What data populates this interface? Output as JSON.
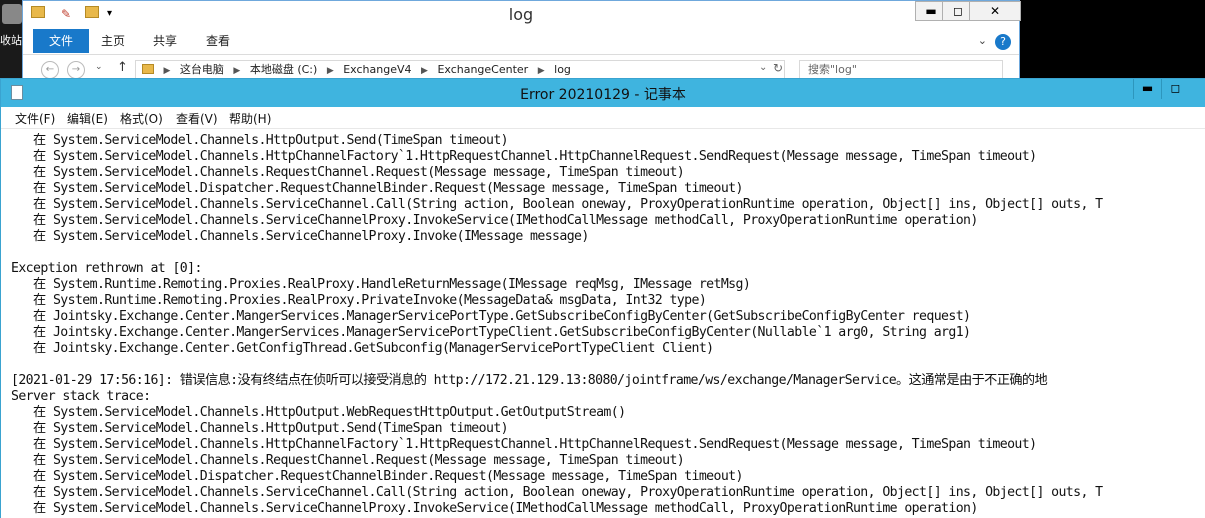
{
  "desktop": {
    "label": "收站"
  },
  "explorer": {
    "title": "log",
    "minimize": "▬",
    "maximize": "◻",
    "close": "✕",
    "tabs": [
      "文件",
      "主页",
      "共享",
      "查看"
    ],
    "help": "?",
    "breadcrumb": [
      "这台电脑",
      "本地磁盘 (C:)",
      "ExchangeV4",
      "ExchangeCenter",
      "log"
    ],
    "search_placeholder": "搜索\"log\""
  },
  "notepad": {
    "title": "Error 20210129 - 记事本",
    "minimize": "▬",
    "maximize": "◻",
    "menu": [
      "文件(F)",
      "编辑(E)",
      "格式(O)",
      "查看(V)",
      "帮助(H)"
    ],
    "lines": [
      "   在 System.ServiceModel.Channels.HttpOutput.Send(TimeSpan timeout)",
      "   在 System.ServiceModel.Channels.HttpChannelFactory`1.HttpRequestChannel.HttpChannelRequest.SendRequest(Message message, TimeSpan timeout)",
      "   在 System.ServiceModel.Channels.RequestChannel.Request(Message message, TimeSpan timeout)",
      "   在 System.ServiceModel.Dispatcher.RequestChannelBinder.Request(Message message, TimeSpan timeout)",
      "   在 System.ServiceModel.Channels.ServiceChannel.Call(String action, Boolean oneway, ProxyOperationRuntime operation, Object[] ins, Object[] outs, T",
      "   在 System.ServiceModel.Channels.ServiceChannelProxy.InvokeService(IMethodCallMessage methodCall, ProxyOperationRuntime operation)",
      "   在 System.ServiceModel.Channels.ServiceChannelProxy.Invoke(IMessage message)",
      "",
      "Exception rethrown at [0]:",
      "   在 System.Runtime.Remoting.Proxies.RealProxy.HandleReturnMessage(IMessage reqMsg, IMessage retMsg)",
      "   在 System.Runtime.Remoting.Proxies.RealProxy.PrivateInvoke(MessageData& msgData, Int32 type)",
      "   在 Jointsky.Exchange.Center.MangerServices.ManagerServicePortType.GetSubscribeConfigByCenter(GetSubscribeConfigByCenter request)",
      "   在 Jointsky.Exchange.Center.MangerServices.ManagerServicePortTypeClient.GetSubscribeConfigByCenter(Nullable`1 arg0, String arg1)",
      "   在 Jointsky.Exchange.Center.GetConfigThread.GetSubconfig(ManagerServicePortTypeClient Client)",
      "",
      "[2021-01-29 17:56:16]: 错误信息:没有终结点在侦听可以接受消息的 http://172.21.129.13:8080/jointframe/ws/exchange/ManagerService。这通常是由于不正确的地",
      "Server stack trace:",
      "   在 System.ServiceModel.Channels.HttpOutput.WebRequestHttpOutput.GetOutputStream()",
      "   在 System.ServiceModel.Channels.HttpOutput.Send(TimeSpan timeout)",
      "   在 System.ServiceModel.Channels.HttpChannelFactory`1.HttpRequestChannel.HttpChannelRequest.SendRequest(Message message, TimeSpan timeout)",
      "   在 System.ServiceModel.Channels.RequestChannel.Request(Message message, TimeSpan timeout)",
      "   在 System.ServiceModel.Dispatcher.RequestChannelBinder.Request(Message message, TimeSpan timeout)",
      "   在 System.ServiceModel.Channels.ServiceChannel.Call(String action, Boolean oneway, ProxyOperationRuntime operation, Object[] ins, Object[] outs, T",
      "   在 System.ServiceModel.Channels.ServiceChannelProxy.InvokeService(IMethodCallMessage methodCall, ProxyOperationRuntime operation)"
    ]
  }
}
